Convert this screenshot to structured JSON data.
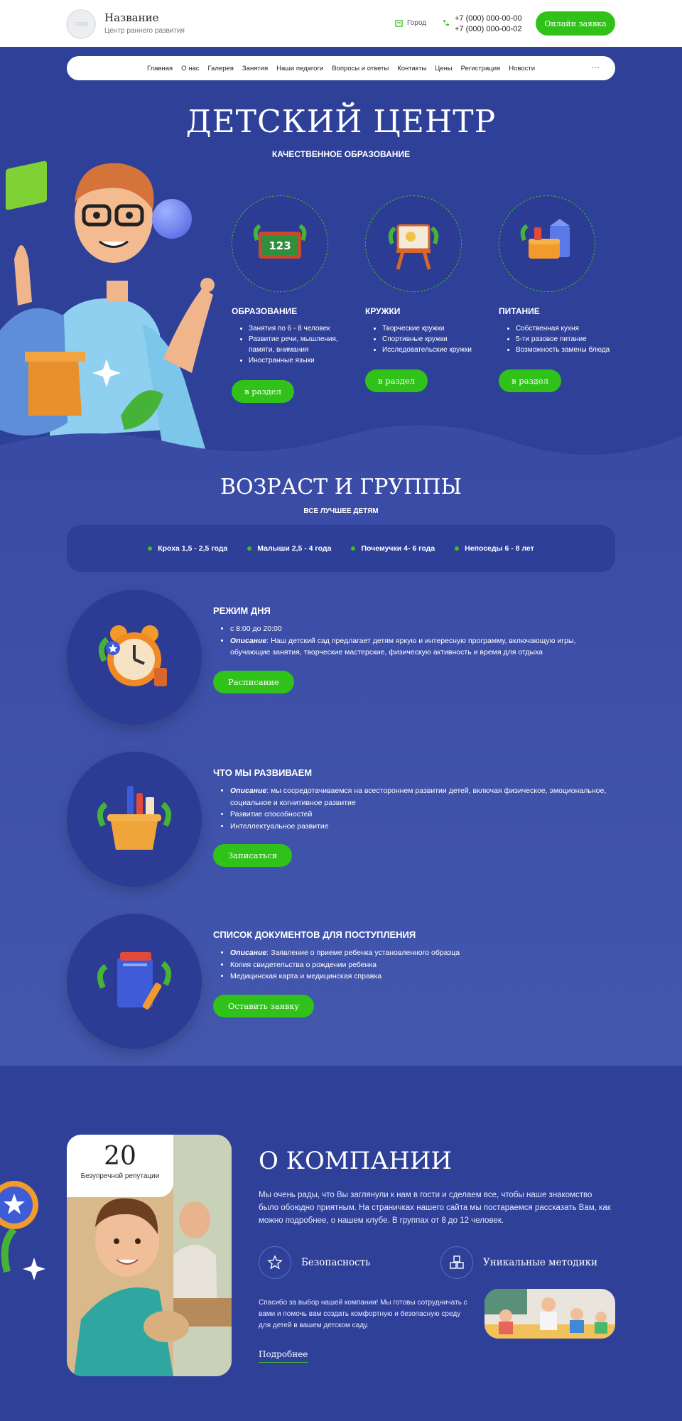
{
  "header": {
    "logo_text": "LOGO",
    "brand_name": "Название",
    "brand_tagline": "Центр раннего развития",
    "city": "Город",
    "phones": [
      "+7 (000) 000-00-00",
      "+7 (000) 000-00-02"
    ],
    "cta_label": "Онлайн заявка"
  },
  "nav": {
    "items": [
      "Главная",
      "О нас",
      "Галерея",
      "Занятия",
      "Наши педагоги",
      "Вопросы и ответы",
      "Контакты",
      "Цены",
      "Регистрация",
      "Новости"
    ],
    "more": "···"
  },
  "hero": {
    "title": "ДЕТСКИЙ ЦЕНТР",
    "subtitle": "КАЧЕСТВЕННОЕ ОБРАЗОВАНИЕ",
    "cards": [
      {
        "title": "ОБРАЗОВАНИЕ",
        "items": [
          "Занятия по 6 - 8 человек",
          "Развитие речи, мышления, памяти, внимания",
          "Иностранные языки"
        ],
        "button": "в раздел",
        "icon": "chalkboard-123-icon"
      },
      {
        "title": "КРУЖКИ",
        "items": [
          "Творческие кружки",
          "Спортивные кружки",
          "Исследовательские кружки"
        ],
        "button": "в раздел",
        "icon": "easel-icon"
      },
      {
        "title": "ПИТАНИЕ",
        "items": [
          "Собственная кухня",
          "5-ти разовое питание",
          "Возможность замены блюда"
        ],
        "button": "в раздел",
        "icon": "lunch-box-icon"
      }
    ]
  },
  "groups": {
    "title": "ВОЗРАСТ И ГРУППЫ",
    "subtitle": "ВСЕ ЛУЧШЕЕ ДЕТЯМ",
    "items": [
      "Кроха 1,5 - 2,5 года",
      "Малыши 2,5 - 4 года",
      "Почемучки 4- 6 года",
      "Непоседы 6 - 8 лет"
    ]
  },
  "rows": [
    {
      "title": "РЕЖИМ ДНЯ",
      "items": [
        {
          "label": "",
          "text": "с 8:00 до 20:00"
        },
        {
          "label": "Описание",
          "text": ": Наш детский сад предлагает детям яркую и интересную программу, включающую игры, обучающие занятия, творческие мастерские, физическую активность и время для отдыха"
        }
      ],
      "button": "Расписание",
      "icon": "alarm-clock-icon"
    },
    {
      "title": "ЧТО МЫ РАЗВИВАЕМ",
      "items": [
        {
          "label": "Описание",
          "text": ": мы сосредотачиваемся на всестороннем развитии детей, включая физическое, эмоциональное, социальное и когнитивное развитие"
        },
        {
          "label": "",
          "text": "Развитие способностей"
        },
        {
          "label": "",
          "text": "Интеллектуальное развитие"
        }
      ],
      "button": "Записаться",
      "icon": "pencil-basket-icon"
    },
    {
      "title": "СПИСОК ДОКУМЕНТОВ ДЛЯ ПОСТУПЛЕНИЯ",
      "items": [
        {
          "label": "Описание",
          "text": ": Заявление о приеме ребенка установленного образца"
        },
        {
          "label": "",
          "text": "Копия свидетельства о рождении ребенка"
        },
        {
          "label": "",
          "text": "Медицинская карта и медицинская справка"
        }
      ],
      "button": "Оставить заявку",
      "icon": "books-icon"
    }
  ],
  "about": {
    "badge_number": "20",
    "badge_label": "Безупречной репутации",
    "title": "О КОМПАНИИ",
    "text": "Мы очень рады, что Вы заглянули к нам в гости и сделаем все, чтобы наше знакомство было обоюдно приятным. На страничках нашего сайта мы постараемся рассказать Вам, как можно подробнее, о нашем клубе. В группах от 8 до 12 человек.",
    "features": [
      {
        "label": "Безопасность",
        "icon": "star-shield-icon"
      },
      {
        "label": "Уникальные методики",
        "icon": "blocks-icon"
      }
    ],
    "small_text": "Спасибо за выбор нашей компании! Мы готовы сотрудничать с вами и помочь вам создать комфортную и безопасную среду для детей в вашем детском саду.",
    "more_link": "Подробнее"
  },
  "colors": {
    "primary_bg": "#2f4099",
    "accent_green": "#31c21a",
    "header_bg": "#ffffff"
  }
}
